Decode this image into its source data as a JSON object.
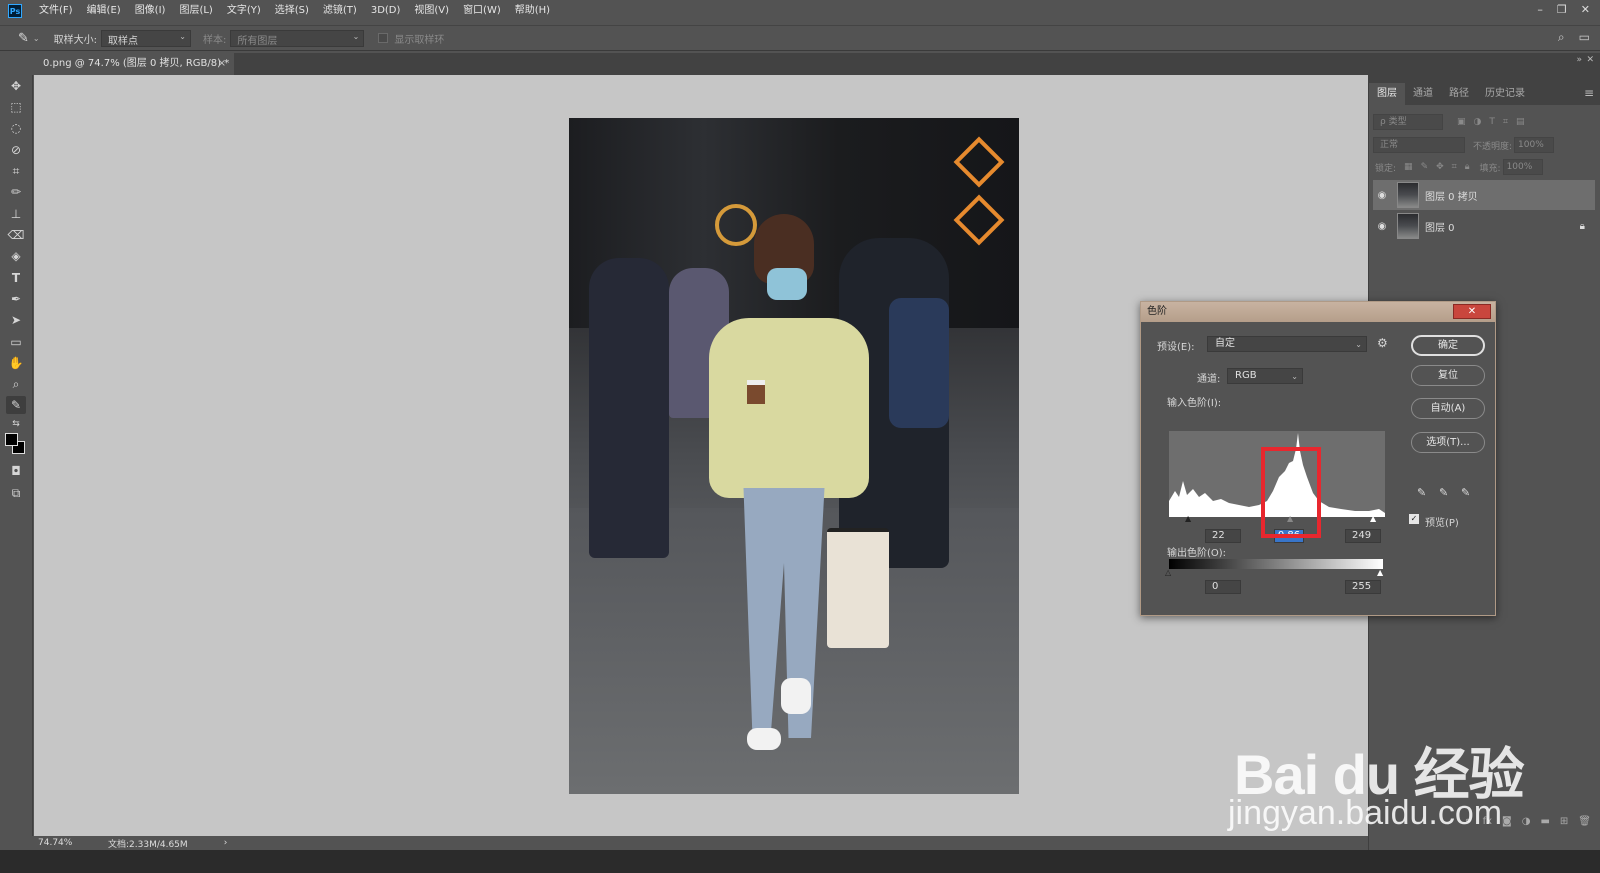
{
  "menubar": {
    "items": [
      "文件(F)",
      "编辑(E)",
      "图像(I)",
      "图层(L)",
      "文字(Y)",
      "选择(S)",
      "滤镜(T)",
      "3D(D)",
      "视图(V)",
      "窗口(W)",
      "帮助(H)"
    ],
    "window_controls": [
      "–",
      "❐",
      "✕"
    ]
  },
  "options": {
    "sample_size_label": "取样大小:",
    "sample_size_value": "取样点",
    "sample_label": "样本:",
    "sample_value": "所有图层",
    "show_ring_label": "显示取样环"
  },
  "document": {
    "tab_title": "0.png @ 74.7% (图层 0 拷贝, RGB/8) *",
    "close": "×"
  },
  "status": {
    "zoom": "74.74%",
    "doc_size": "文档:2.33M/4.65M",
    "arrow": "›"
  },
  "layers_panel": {
    "tabs": [
      "图层",
      "通道",
      "路径",
      "历史记录"
    ],
    "filter_label": "ρ 类型",
    "blend_mode": "正常",
    "opacity_label": "不透明度:",
    "opacity_value": "100%",
    "lock_label": "锁定:",
    "fill_label": "填充:",
    "fill_value": "100%",
    "layers": [
      {
        "name": "图层 0 拷贝",
        "selected": true
      },
      {
        "name": "图层 0",
        "locked": true
      }
    ]
  },
  "levels_dialog": {
    "title": "色阶",
    "close": "✕",
    "preset_label": "预设(E):",
    "preset_value": "自定",
    "channel_label": "通道:",
    "channel_value": "RGB",
    "input_label": "输入色阶(I):",
    "input_black": "22",
    "input_gamma": "0.86",
    "input_white": "249",
    "output_label": "输出色阶(O):",
    "output_black": "0",
    "output_white": "255",
    "buttons": {
      "ok": "确定",
      "reset": "复位",
      "auto": "自动(A)",
      "options": "选项(T)..."
    },
    "preview_label": "预览(P)",
    "preview_checked": true
  },
  "watermark": {
    "brand": "Bai du 经验",
    "url": "jingyan.baidu.com"
  },
  "colors": {
    "ui_bg": "#535353",
    "canvas_bg": "#c6c6c6",
    "highlight_blue": "#3875c9",
    "red_annotation": "#e8272e"
  }
}
